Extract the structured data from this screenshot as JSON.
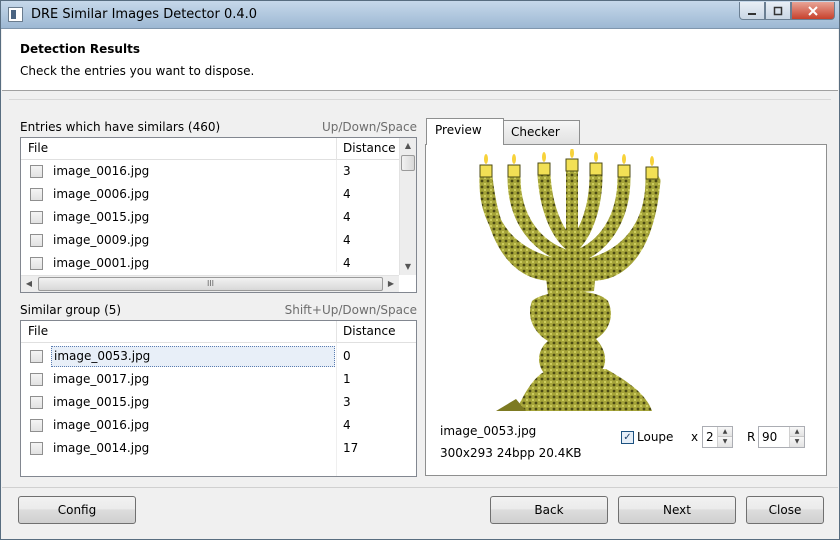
{
  "window": {
    "title": "DRE Similar Images Detector 0.4.0"
  },
  "header": {
    "title": "Detection Results",
    "subtitle": "Check the entries you want to dispose."
  },
  "entries": {
    "label": "Entries which have similars (460)",
    "hint": "Up/Down/Space",
    "columns": {
      "file": "File",
      "distance": "Distance"
    },
    "rows": [
      {
        "file": "image_0016.jpg",
        "distance": "3"
      },
      {
        "file": "image_0006.jpg",
        "distance": "4"
      },
      {
        "file": "image_0015.jpg",
        "distance": "4"
      },
      {
        "file": "image_0009.jpg",
        "distance": "4"
      },
      {
        "file": "image_0001.jpg",
        "distance": "4"
      }
    ]
  },
  "similar": {
    "label": "Similar group (5)",
    "hint": "Shift+Up/Down/Space",
    "columns": {
      "file": "File",
      "distance": "Distance"
    },
    "rows": [
      {
        "file": "image_0053.jpg",
        "distance": "0"
      },
      {
        "file": "image_0017.jpg",
        "distance": "1"
      },
      {
        "file": "image_0015.jpg",
        "distance": "3"
      },
      {
        "file": "image_0016.jpg",
        "distance": "4"
      },
      {
        "file": "image_0014.jpg",
        "distance": "17"
      }
    ]
  },
  "tabs": {
    "preview": "Preview",
    "checker": "Checker"
  },
  "preview": {
    "image_name": "image_0053.jpg",
    "image_meta": "300x293 24bpp 20.4KB",
    "loupe_label": "Loupe",
    "loupe_checked": true,
    "x_label": "x",
    "zoom": "2",
    "r_label": "R",
    "radius": "90"
  },
  "footer": {
    "config": "Config",
    "back": "Back",
    "next": "Next",
    "close": "Close"
  },
  "icons": {
    "check": "✓",
    "up": "▲",
    "down": "▼",
    "left": "◀",
    "right": "▶",
    "grip": "III"
  }
}
